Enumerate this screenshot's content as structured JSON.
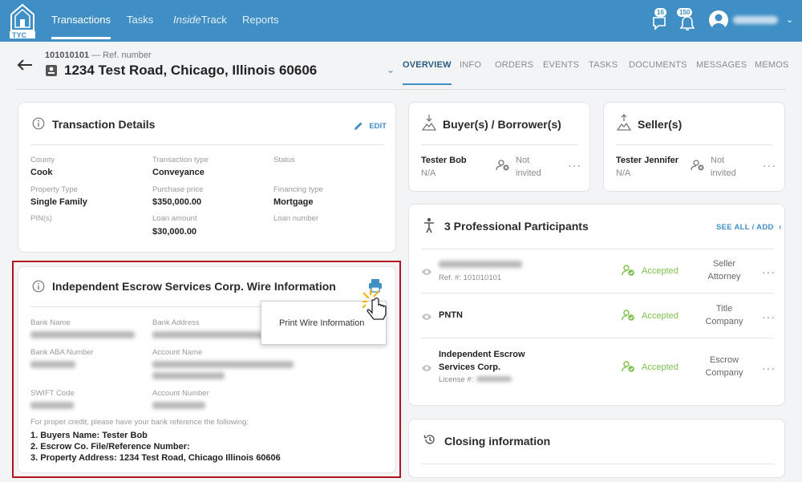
{
  "nav": {
    "logo_text": "TYC",
    "items": [
      {
        "label": "Transactions"
      },
      {
        "label": "Tasks"
      },
      {
        "label_italic": "Inside",
        "label_rest": "Track"
      },
      {
        "label": "Reports"
      }
    ],
    "chat_count": "16",
    "bell_count": "150"
  },
  "header": {
    "ref_number": "101010101",
    "ref_suffix": "— Ref. number",
    "address": "1234 Test Road, Chicago, Illinois 60606",
    "tabs": [
      "OVERVIEW",
      "INFO",
      "ORDERS",
      "EVENTS",
      "TASKS",
      "DOCUMENTS",
      "MESSAGES",
      "MEMOS"
    ]
  },
  "details": {
    "title": "Transaction Details",
    "edit_label": "EDIT",
    "fields": {
      "county_label": "County",
      "county_value": "Cook",
      "ttype_label": "Transaction type",
      "ttype_value": "Conveyance",
      "status_label": "Status",
      "ptype_label": "Property Type",
      "ptype_value": "Single Family",
      "price_label": "Purchase price",
      "price_value": "$350,000.00",
      "fin_label": "Financing type",
      "fin_value": "Mortgage",
      "pin_label": "PIN(s)",
      "loan_label": "Loan amount",
      "loan_value": "$30,000.00",
      "loannum_label": "Loan number"
    }
  },
  "wire": {
    "title": "Independent Escrow Services Corp. Wire Information",
    "bank_name_label": "Bank Name",
    "bank_address_label": "Bank Address",
    "aba_label": "Bank ABA Number",
    "account_name_label": "Account Name",
    "swift_label": "SWIFT Code",
    "account_number_label": "Account Number",
    "note": "For proper credit, please have your bank reference the following:",
    "line1": "1. Buyers Name: Tester Bob",
    "line2": "2. Escrow Co. File/Reference Number:",
    "line3": "3. Property Address: 1234 Test Road, Chicago Illinois 60606",
    "popup_item": "Print Wire Information"
  },
  "buyers": {
    "title": "Buyer(s) / Borrower(s)",
    "name": "Tester Bob",
    "sub": "N/A",
    "status_line1": "Not",
    "status_line2": "invited"
  },
  "sellers": {
    "title": "Seller(s)",
    "name": "Tester Jennifer",
    "sub": "N/A",
    "status_line1": "Not",
    "status_line2": "invited"
  },
  "participants": {
    "title": "3 Professional Participants",
    "see_all": "SEE ALL / ADD",
    "rows": [
      {
        "ref_prefix": "Ref. #: 101010101",
        "status": "Accepted",
        "role_line1": "Seller",
        "role_line2": "Attorney"
      },
      {
        "name": "PNTN",
        "status": "Accepted",
        "role_line1": "Title",
        "role_line2": "Company"
      },
      {
        "name_line1": "Independent Escrow",
        "name_line2": "Services Corp.",
        "license_prefix": "License #:",
        "status": "Accepted",
        "role_line1": "Escrow",
        "role_line2": "Company"
      }
    ]
  },
  "closing": {
    "title": "Closing information"
  },
  "colors": {
    "brand": "#3f8fc5",
    "accepted": "#7cc24b",
    "highlight": "#b3121d"
  }
}
